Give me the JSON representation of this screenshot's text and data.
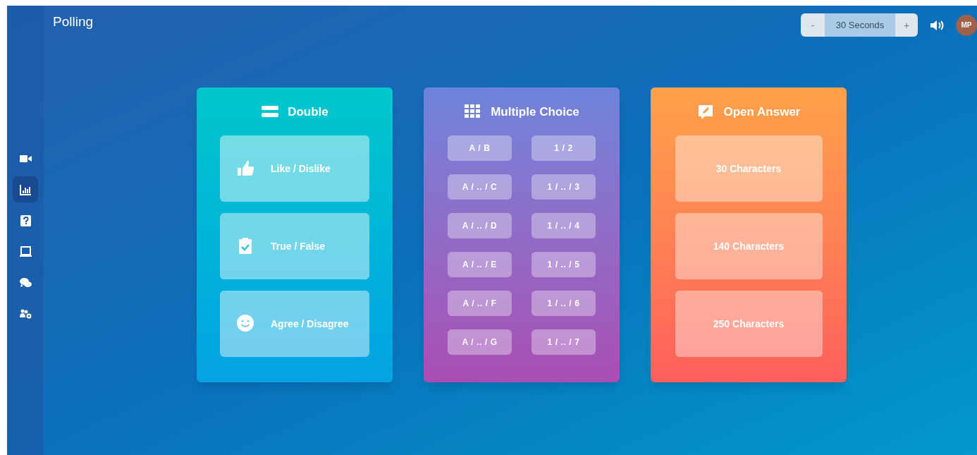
{
  "header": {
    "title": "Polling"
  },
  "timer": {
    "minus": "-",
    "value": "30 Seconds",
    "plus": "+"
  },
  "avatar": {
    "initials": "MP"
  },
  "sidebar": {
    "items": [
      {
        "kind": "video",
        "selected": false
      },
      {
        "kind": "chart",
        "selected": true
      },
      {
        "kind": "question",
        "selected": false
      },
      {
        "kind": "screen",
        "selected": false
      },
      {
        "kind": "chat",
        "selected": false
      },
      {
        "kind": "users",
        "selected": false
      }
    ]
  },
  "cards": [
    {
      "kind": "double",
      "title": "Double",
      "options": [
        {
          "kind": "like",
          "label": "Like / Dislike"
        },
        {
          "kind": "truefalse",
          "label": "True / False"
        },
        {
          "kind": "agree",
          "label": "Agree / Disagree"
        }
      ]
    },
    {
      "kind": "multiple",
      "title": "Multiple Choice",
      "options": [
        {
          "label": "A / B"
        },
        {
          "label": "1 / 2"
        },
        {
          "label": "A / .. / C"
        },
        {
          "label": "1 / .. / 3"
        },
        {
          "label": "A / .. / D"
        },
        {
          "label": "1 / .. / 4"
        },
        {
          "label": "A / .. / E"
        },
        {
          "label": "1 / .. / 5"
        },
        {
          "label": "A / .. / F"
        },
        {
          "label": "1 / .. / 6"
        },
        {
          "label": "A / .. / G"
        },
        {
          "label": "1 / .. / 7"
        }
      ]
    },
    {
      "kind": "open",
      "title": "Open Answer",
      "options": [
        {
          "label": "30 Characters"
        },
        {
          "label": "140 Characters"
        },
        {
          "label": "250 Characters"
        }
      ]
    }
  ]
}
